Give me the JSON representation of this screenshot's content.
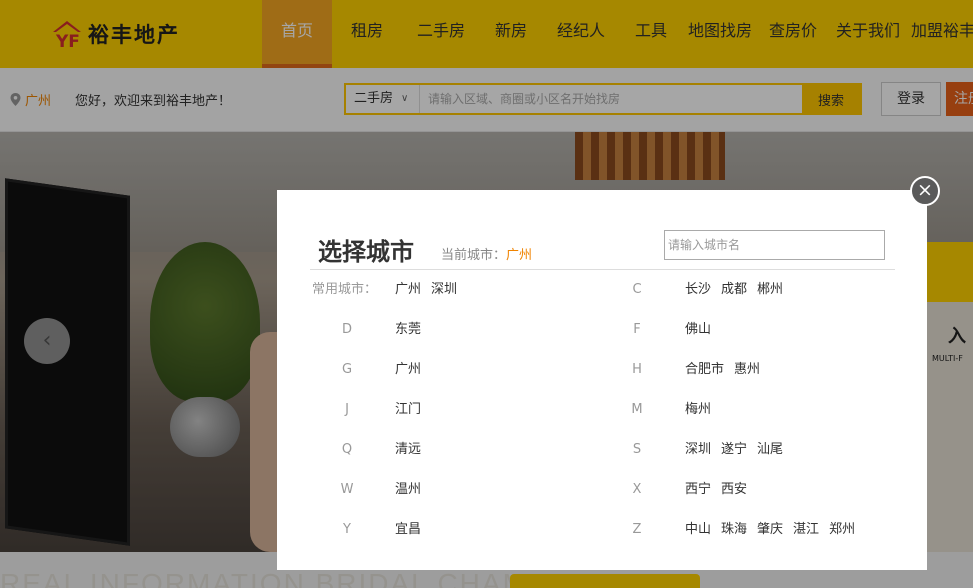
{
  "header": {
    "logo_text": "裕丰地产",
    "nav": [
      {
        "label": "首页",
        "active": true
      },
      {
        "label": "租房"
      },
      {
        "label": "二手房"
      },
      {
        "label": "新房"
      },
      {
        "label": "经纪人"
      },
      {
        "label": "工具"
      },
      {
        "label": "地图找房"
      },
      {
        "label": "查房价"
      },
      {
        "label": "关于我们"
      },
      {
        "label": "加盟裕丰"
      }
    ]
  },
  "subbar": {
    "location_city": "广州",
    "welcome": "您好，欢迎来到裕丰地产！",
    "search": {
      "type": "二手房",
      "placeholder": "请输入区域、商圈或小区名开始找房",
      "button": "搜索"
    },
    "login": "登录",
    "register": "注册"
  },
  "banner": {
    "right_label": "入",
    "right_small": "MULTI-F"
  },
  "bottom": {
    "deco_text": "REAL INFORMATION BRIDAL CHAMBER"
  },
  "modal": {
    "title": "选择城市",
    "current_city_label": "当前城市：",
    "current_city": "广州",
    "search_placeholder": "请输入城市名",
    "common_label": "常用城市：",
    "common_cities": [
      "广州",
      "深圳"
    ],
    "groups_left": [
      {
        "letter": "D",
        "cities": [
          "东莞"
        ]
      },
      {
        "letter": "G",
        "cities": [
          "广州"
        ]
      },
      {
        "letter": "J",
        "cities": [
          "江门"
        ]
      },
      {
        "letter": "Q",
        "cities": [
          "清远"
        ]
      },
      {
        "letter": "W",
        "cities": [
          "温州"
        ]
      },
      {
        "letter": "Y",
        "cities": [
          "宜昌"
        ]
      }
    ],
    "groups_right": [
      {
        "letter": "C",
        "cities": [
          "长沙",
          "成都",
          "郴州"
        ]
      },
      {
        "letter": "F",
        "cities": [
          "佛山"
        ]
      },
      {
        "letter": "H",
        "cities": [
          "合肥市",
          "惠州"
        ]
      },
      {
        "letter": "M",
        "cities": [
          "梅州"
        ]
      },
      {
        "letter": "S",
        "cities": [
          "深圳",
          "遂宁",
          "汕尾"
        ]
      },
      {
        "letter": "X",
        "cities": [
          "西宁",
          "西安"
        ]
      },
      {
        "letter": "Z",
        "cities": [
          "中山",
          "珠海",
          "肇庆",
          "湛江",
          "郑州"
        ]
      }
    ]
  },
  "colors": {
    "brand_yellow": "#ffd200",
    "accent_orange": "#f08300",
    "nav_active": "#f5a623"
  }
}
